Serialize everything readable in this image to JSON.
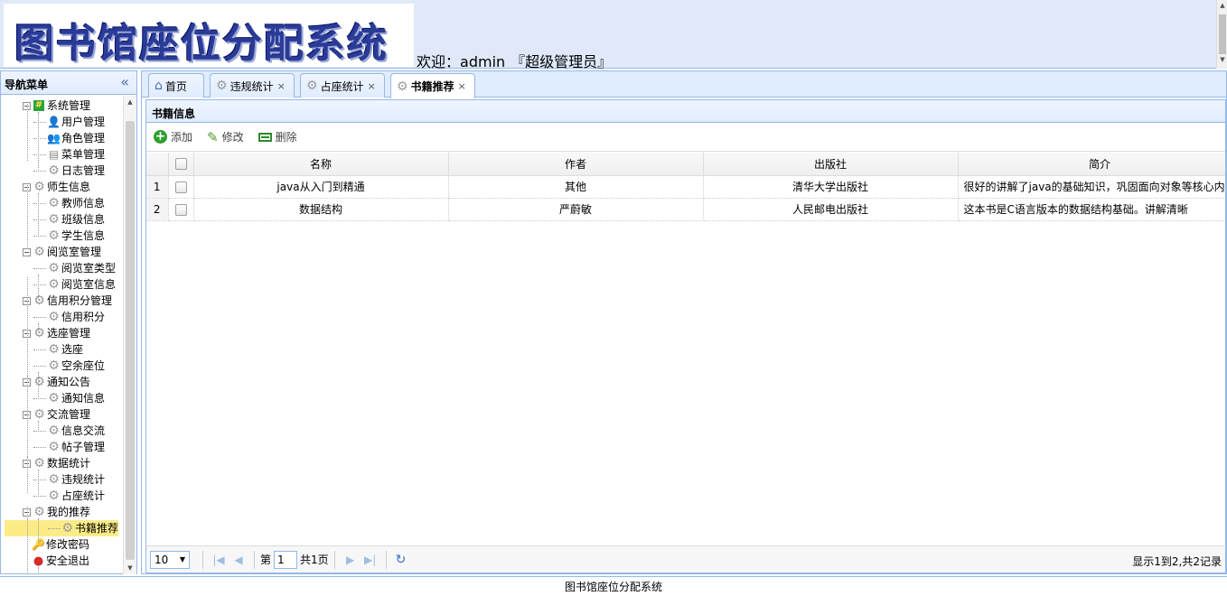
{
  "header": {
    "logo_text": "图书馆座位分配系统",
    "welcome_prefix": "欢迎：",
    "username": "admin",
    "role": "『超级管理员』"
  },
  "nav": {
    "title": "导航菜单",
    "collapse_glyph": "«",
    "items": [
      {
        "label": "系统管理",
        "level": 1,
        "icon": "system-icon"
      },
      {
        "label": "用户管理",
        "level": 2,
        "icon": "user-icon"
      },
      {
        "label": "角色管理",
        "level": 2,
        "icon": "role-icon"
      },
      {
        "label": "菜单管理",
        "level": 2,
        "icon": "menu-icon"
      },
      {
        "label": "日志管理",
        "level": 2,
        "icon": "gear-icon"
      },
      {
        "label": "师生信息",
        "level": 1,
        "icon": "gear-icon"
      },
      {
        "label": "教师信息",
        "level": 2,
        "icon": "gear-icon"
      },
      {
        "label": "班级信息",
        "level": 2,
        "icon": "gear-icon"
      },
      {
        "label": "学生信息",
        "level": 2,
        "icon": "gear-icon"
      },
      {
        "label": "阅览室管理",
        "level": 1,
        "icon": "gear-icon"
      },
      {
        "label": "阅览室类型",
        "level": 2,
        "icon": "gear-icon"
      },
      {
        "label": "阅览室信息",
        "level": 2,
        "icon": "gear-icon"
      },
      {
        "label": "信用积分管理",
        "level": 1,
        "icon": "gear-icon"
      },
      {
        "label": "信用积分",
        "level": 2,
        "icon": "gear-icon"
      },
      {
        "label": "选座管理",
        "level": 1,
        "icon": "gear-icon"
      },
      {
        "label": "选座",
        "level": 2,
        "icon": "gear-icon"
      },
      {
        "label": "空余座位",
        "level": 2,
        "icon": "gear-icon"
      },
      {
        "label": "通知公告",
        "level": 1,
        "icon": "gear-icon"
      },
      {
        "label": "通知信息",
        "level": 2,
        "icon": "gear-icon"
      },
      {
        "label": "交流管理",
        "level": 1,
        "icon": "gear-icon"
      },
      {
        "label": "信息交流",
        "level": 2,
        "icon": "gear-icon"
      },
      {
        "label": "帖子管理",
        "level": 2,
        "icon": "gear-icon"
      },
      {
        "label": "数据统计",
        "level": 1,
        "icon": "gear-icon"
      },
      {
        "label": "违规统计",
        "level": 2,
        "icon": "gear-icon"
      },
      {
        "label": "占座统计",
        "level": 2,
        "icon": "gear-icon"
      },
      {
        "label": "我的推荐",
        "level": 1,
        "icon": "gear-icon"
      },
      {
        "label": "书籍推荐",
        "level": 2,
        "icon": "gear-icon",
        "selected": true
      },
      {
        "label": "修改密码",
        "level": 0,
        "icon": "key-icon"
      },
      {
        "label": "安全退出",
        "level": 0,
        "icon": "exit-icon"
      }
    ]
  },
  "tabs": [
    {
      "label": "首页",
      "icon": "home-icon",
      "closable": false
    },
    {
      "label": "违规统计",
      "icon": "gear-icon",
      "closable": true
    },
    {
      "label": "占座统计",
      "icon": "gear-icon",
      "closable": true
    },
    {
      "label": "书籍推荐",
      "icon": "gear-icon",
      "closable": true,
      "active": true
    }
  ],
  "panel": {
    "title": "书籍信息",
    "toolbar": {
      "add": "添加",
      "edit": "修改",
      "delete": "删除"
    }
  },
  "table": {
    "columns": [
      "名称",
      "作者",
      "出版社",
      "简介"
    ],
    "rows": [
      {
        "no": "1",
        "name": "java从入门到精通",
        "author": "其他",
        "publisher": "清华大学出版社",
        "intro": "很好的讲解了java的基础知识，巩固面向对象等核心内容"
      },
      {
        "no": "2",
        "name": "数据结构",
        "author": "严蔚敏",
        "publisher": "人民邮电出版社",
        "intro": "这本书是C语言版本的数据结构基础。讲解清晰"
      }
    ]
  },
  "pager": {
    "page_size": "10",
    "page_prefix": "第",
    "page_value": "1",
    "page_total": "共1页",
    "info": "显示1到2,共2记录"
  },
  "footer": {
    "text": "图书馆座位分配系统"
  },
  "colors": {
    "border": "#95b8e7",
    "header_bg": "#dfe9f9",
    "selected": "#fbec88",
    "logo": "#2a3b97"
  }
}
